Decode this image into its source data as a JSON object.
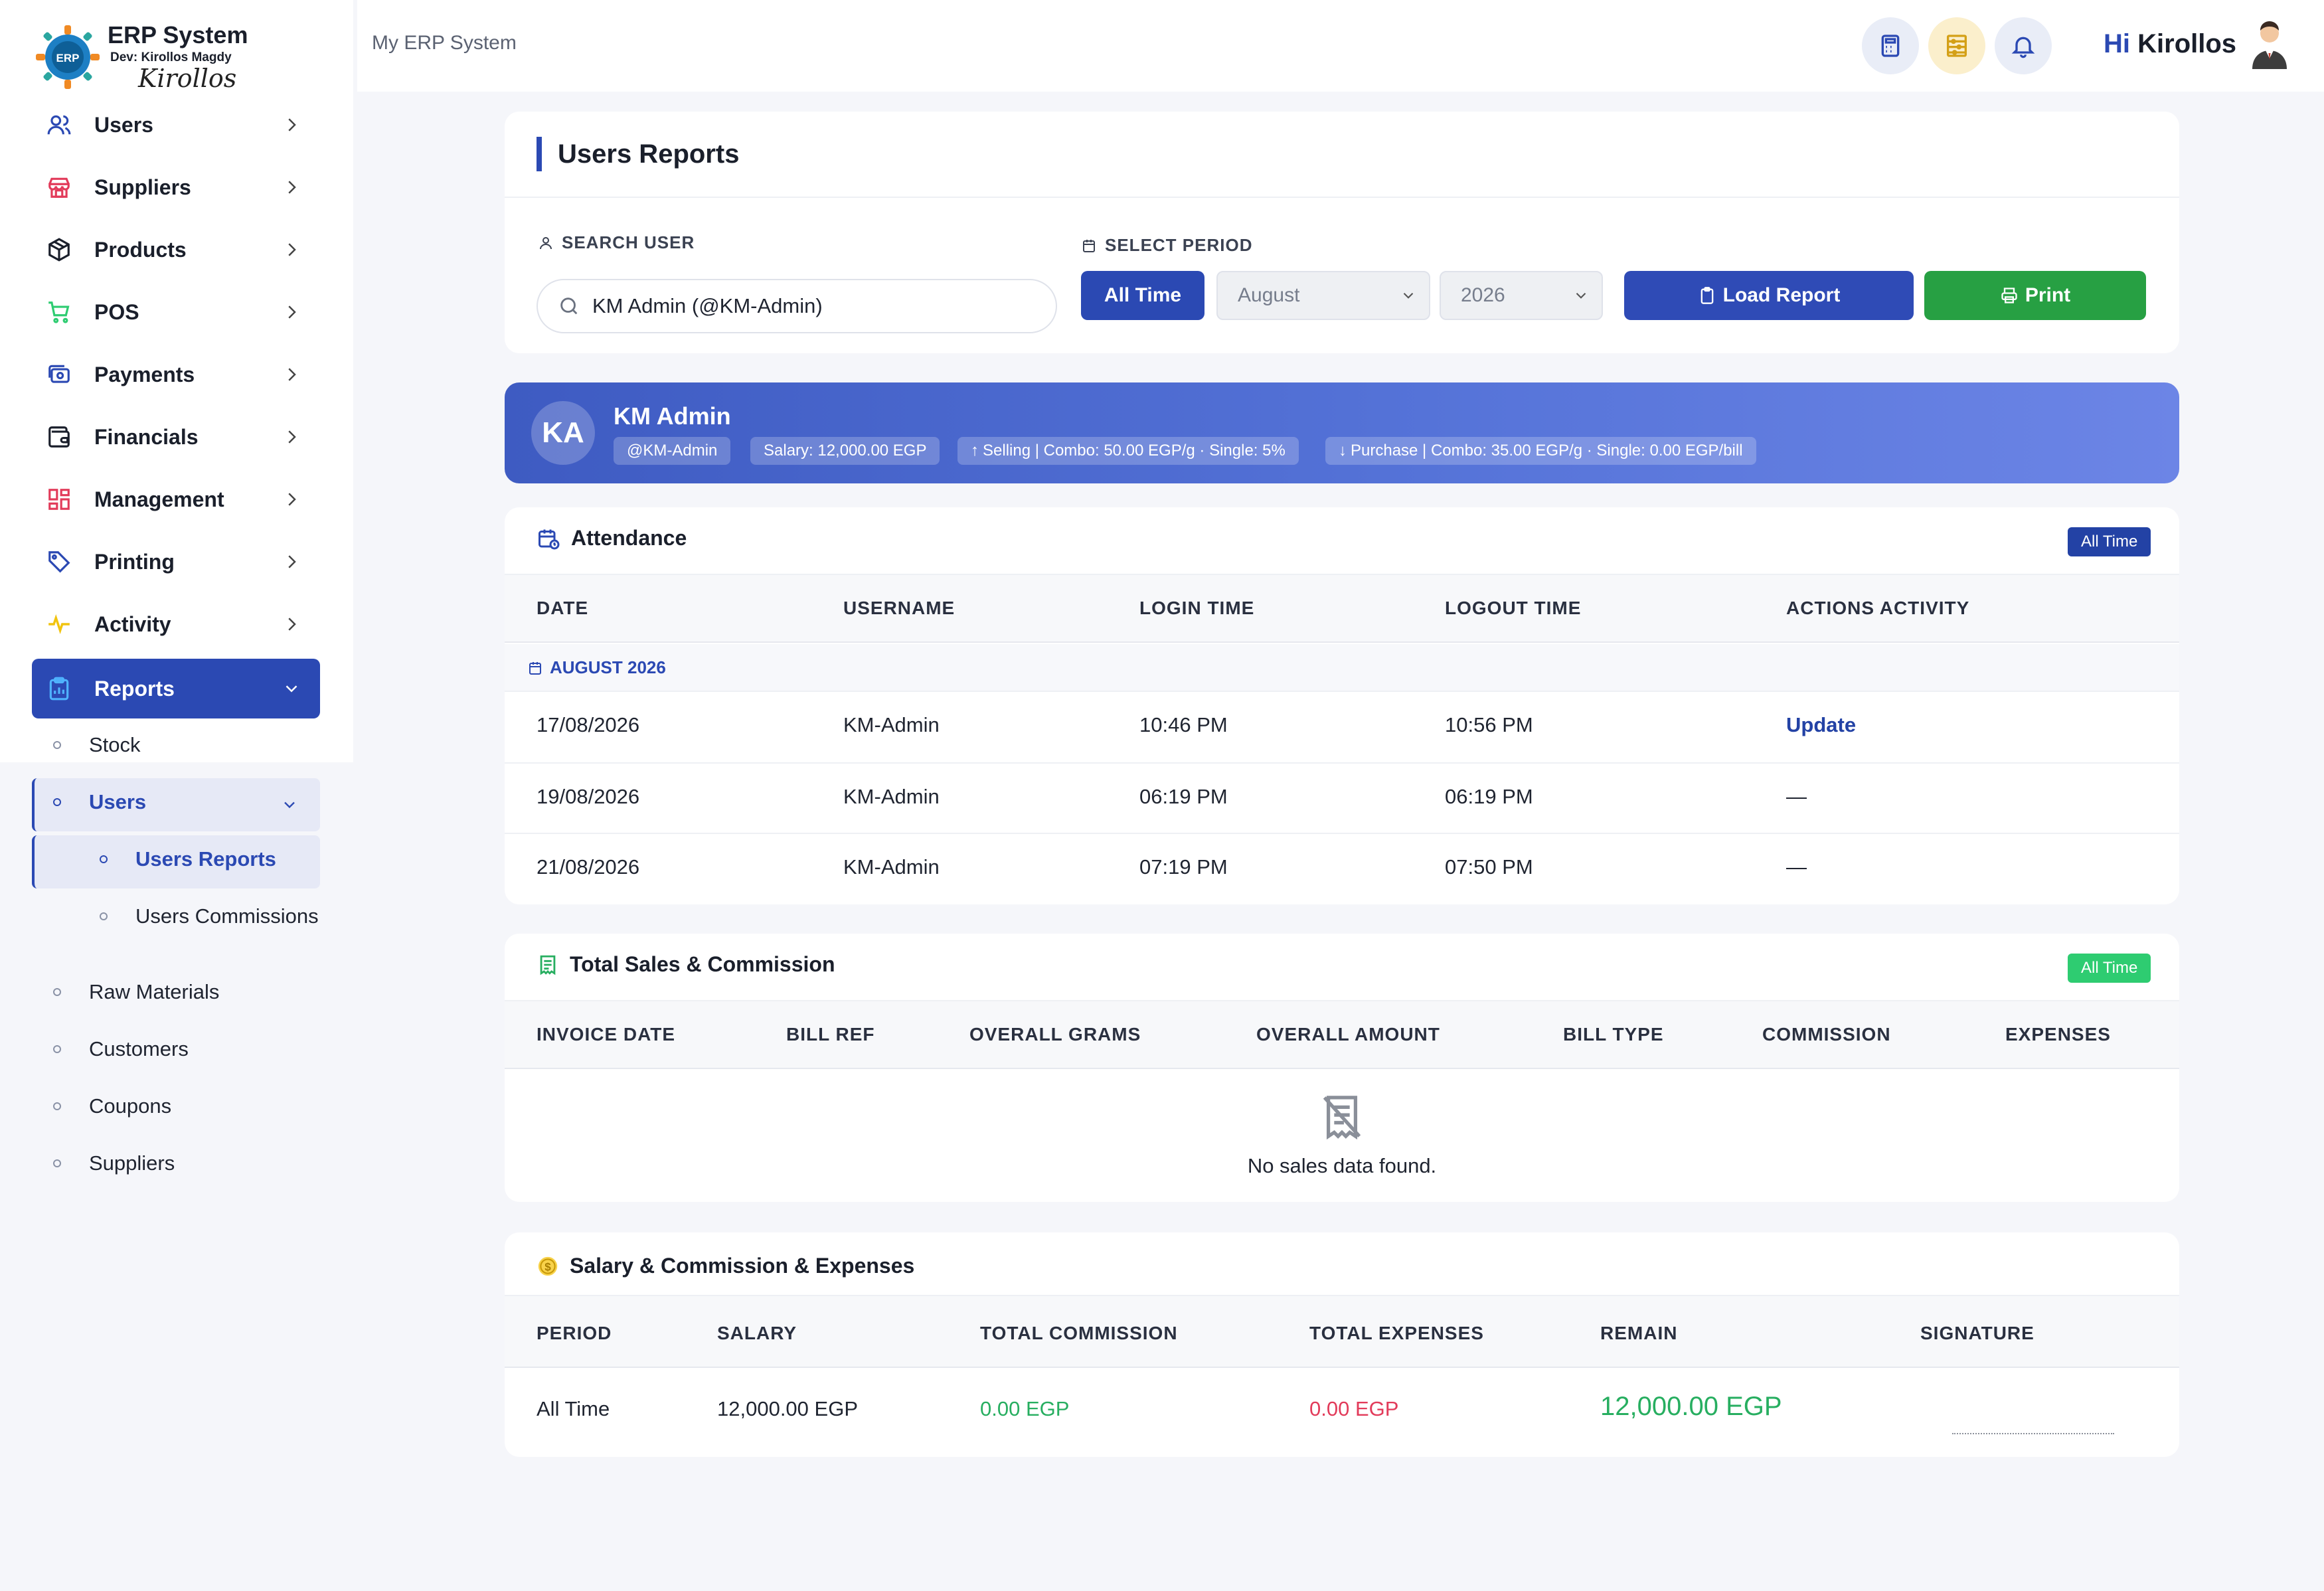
{
  "brand": {
    "title": "ERP System",
    "dev": "Dev: Kirollos Magdy",
    "signature": "Kirollos",
    "gear_text": "ERP"
  },
  "sidebar": {
    "items": [
      {
        "label": "Users",
        "icon": "users-icon"
      },
      {
        "label": "Suppliers",
        "icon": "store-icon"
      },
      {
        "label": "Products",
        "icon": "box-icon"
      },
      {
        "label": "POS",
        "icon": "cart-icon"
      },
      {
        "label": "Payments",
        "icon": "cash-icon"
      },
      {
        "label": "Financials",
        "icon": "wallet-icon"
      },
      {
        "label": "Management",
        "icon": "grid-icon"
      },
      {
        "label": "Printing",
        "icon": "tag-icon"
      },
      {
        "label": "Activity",
        "icon": "pulse-icon"
      },
      {
        "label": "Reports",
        "icon": "clipboard-icon"
      }
    ],
    "reports_sub": {
      "stock": "Stock",
      "users": "Users",
      "users_reports": "Users Reports",
      "users_commissions": "Users Commissions",
      "raw_materials": "Raw Materials",
      "customers": "Customers",
      "coupons": "Coupons",
      "suppliers": "Suppliers"
    }
  },
  "header": {
    "title": "My ERP System",
    "greeting_hi": "Hi",
    "greeting_name": "Kirollos"
  },
  "report": {
    "title": "Users Reports",
    "search_label": "SEARCH USER",
    "search_value": "KM Admin (@KM-Admin)",
    "period_label": "SELECT PERIOD",
    "all_time_btn": "All Time",
    "month": "August",
    "year": "2026",
    "load_btn": "Load Report",
    "print_btn": "Print"
  },
  "user": {
    "initials": "KA",
    "name": "KM Admin",
    "username_chip": "@KM-Admin",
    "salary_chip": "Salary: 12,000.00 EGP",
    "selling_chip": "Selling | Combo: 50.00 EGP/g · Single: 5%",
    "purchase_chip": "Purchase | Combo: 35.00 EGP/g · Single: 0.00 EGP/bill"
  },
  "attendance": {
    "title": "Attendance",
    "badge": "All Time",
    "columns": [
      "DATE",
      "USERNAME",
      "LOGIN TIME",
      "LOGOUT TIME",
      "ACTIONS ACTIVITY"
    ],
    "group": "AUGUST 2026",
    "rows": [
      [
        "17/08/2026",
        "KM-Admin",
        "10:46 PM",
        "10:56 PM",
        "Update"
      ],
      [
        "19/08/2026",
        "KM-Admin",
        "06:19 PM",
        "06:19 PM",
        "—"
      ],
      [
        "21/08/2026",
        "KM-Admin",
        "07:19 PM",
        "07:50 PM",
        "—"
      ]
    ]
  },
  "sales": {
    "title": "Total Sales & Commission",
    "badge": "All Time",
    "columns": [
      "INVOICE DATE",
      "BILL REF",
      "OVERALL GRAMS",
      "OVERALL AMOUNT",
      "BILL TYPE",
      "COMMISSION",
      "EXPENSES"
    ],
    "empty": "No sales data found."
  },
  "salary": {
    "title": "Salary & Commission & Expenses",
    "columns": [
      "PERIOD",
      "SALARY",
      "TOTAL COMMISSION",
      "TOTAL EXPENSES",
      "REMAIN",
      "SIGNATURE"
    ],
    "row": [
      "All Time",
      "12,000.00 EGP",
      "0.00 EGP",
      "0.00 EGP",
      "12,000.00 EGP"
    ]
  },
  "colors": {
    "primary": "#2b49b3",
    "green": "#27a043",
    "badge_green": "#2ecc71",
    "positive": "#27ae60",
    "negative": "#e23b5a"
  }
}
